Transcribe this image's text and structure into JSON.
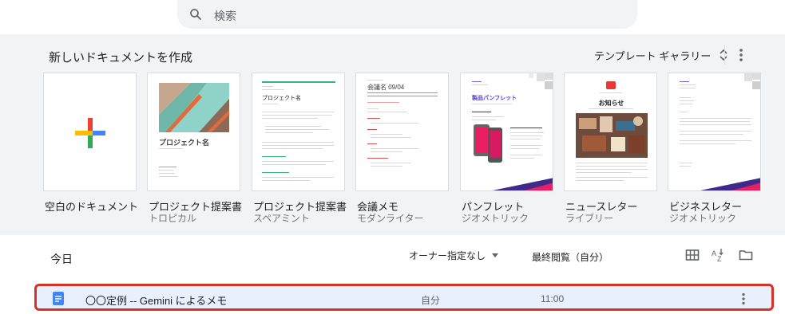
{
  "search": {
    "placeholder": "検索"
  },
  "templates": {
    "heading": "新しいドキュメントを作成",
    "gallery_label": "テンプレート ギャラリー",
    "items": [
      {
        "name": "空白のドキュメント",
        "sub": ""
      },
      {
        "name": "プロジェクト提案書",
        "sub": "トロピカル",
        "thumb_title": "プロジェクト名"
      },
      {
        "name": "プロジェクト提案書",
        "sub": "スペアミント",
        "thumb_title": "プロジェクト名"
      },
      {
        "name": "会議メモ",
        "sub": "モダンライター",
        "thumb_title": "会議名 09/04"
      },
      {
        "name": "パンフレット",
        "sub": "ジオメトリック",
        "thumb_title": "製品パンフレット"
      },
      {
        "name": "ニュースレター",
        "sub": "ライブリー",
        "thumb_title": "お知らせ"
      },
      {
        "name": "ビジネスレター",
        "sub": "ジオメトリック"
      }
    ]
  },
  "documents": {
    "section_label": "今日",
    "owner_filter": "オーナー指定なし",
    "sort_label": "最終閲覧（自分）",
    "rows": [
      {
        "title": "〇〇定例 -- Gemini によるメモ",
        "owner": "自分",
        "time": "11:00"
      }
    ]
  },
  "colors": {
    "accent": "#1a73e8",
    "highlight_border": "#d93025",
    "row_bg": "#e8f0fe"
  }
}
